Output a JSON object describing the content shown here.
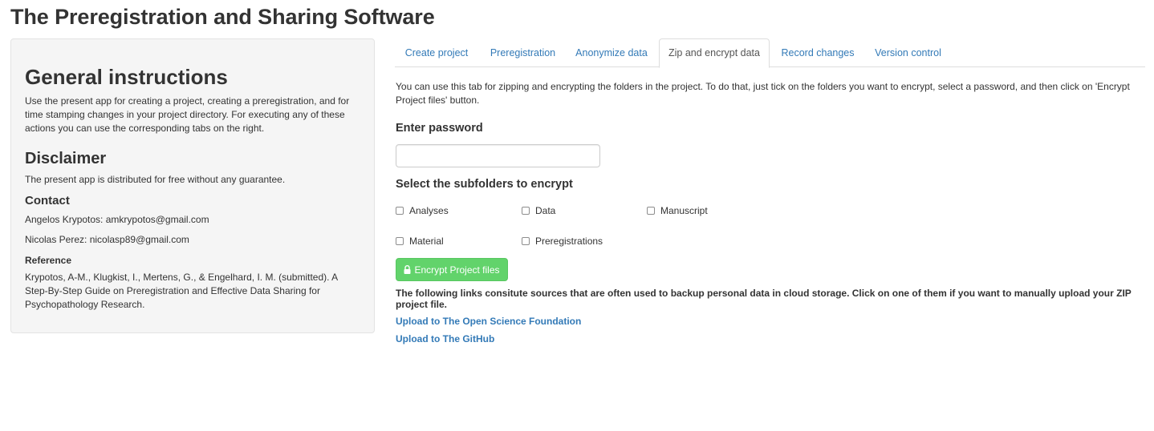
{
  "app": {
    "title": "The Preregistration and Sharing Software"
  },
  "sidebar": {
    "general_heading": "General instructions",
    "general_text": "Use the present app for creating a project, creating a preregistration, and for time stamping changes in your project directory. For executing any of these actions you can use the corresponding tabs on the right.",
    "disclaimer_heading": "Disclaimer",
    "disclaimer_text": "The present app is distributed for free without any guarantee.",
    "contact_heading": "Contact",
    "contact_1": "Angelos Krypotos: amkrypotos@gmail.com",
    "contact_2": "Nicolas Perez: nicolasp89@gmail.com",
    "reference_heading": "Reference",
    "reference_text": "Krypotos, A-M., Klugkist, I., Mertens, G., & Engelhard, I. M. (submitted). A Step-By-Step Guide on Preregistration and Effective Data Sharing for Psychopathology Research."
  },
  "tabs": [
    {
      "label": "Create project"
    },
    {
      "label": "Preregistration"
    },
    {
      "label": "Anonymize data"
    },
    {
      "label": "Zip and encrypt data",
      "active": true
    },
    {
      "label": "Record changes"
    },
    {
      "label": "Version control"
    }
  ],
  "main": {
    "intro": "You can use this tab for zipping and encrypting the folders in the project. To do that, just tick on the folders you want to encrypt, select a password, and then click on 'Encrypt Project files' button.",
    "password_label": "Enter password",
    "password_value": "",
    "subfolders_label": "Select the subfolders to encrypt",
    "subfolders": [
      {
        "label": "Analyses",
        "checked": false
      },
      {
        "label": "Data",
        "checked": false
      },
      {
        "label": "Manuscript",
        "checked": false
      },
      {
        "label": "Material",
        "checked": false
      },
      {
        "label": "Preregistrations",
        "checked": false
      }
    ],
    "encrypt_button": "Encrypt Project files",
    "links_note": "The following links consitute sources that are often used to backup personal data in cloud storage. Click on one of them if you want to manually upload your ZIP project file.",
    "link_osf": "Upload to The Open Science Foundation",
    "link_github": "Upload to The GitHub"
  },
  "colors": {
    "link": "#337ab7",
    "button_green": "#62d36b",
    "sidebar_bg": "#f5f5f5"
  },
  "icons": {
    "encrypt_button_icon": "lock-icon"
  }
}
